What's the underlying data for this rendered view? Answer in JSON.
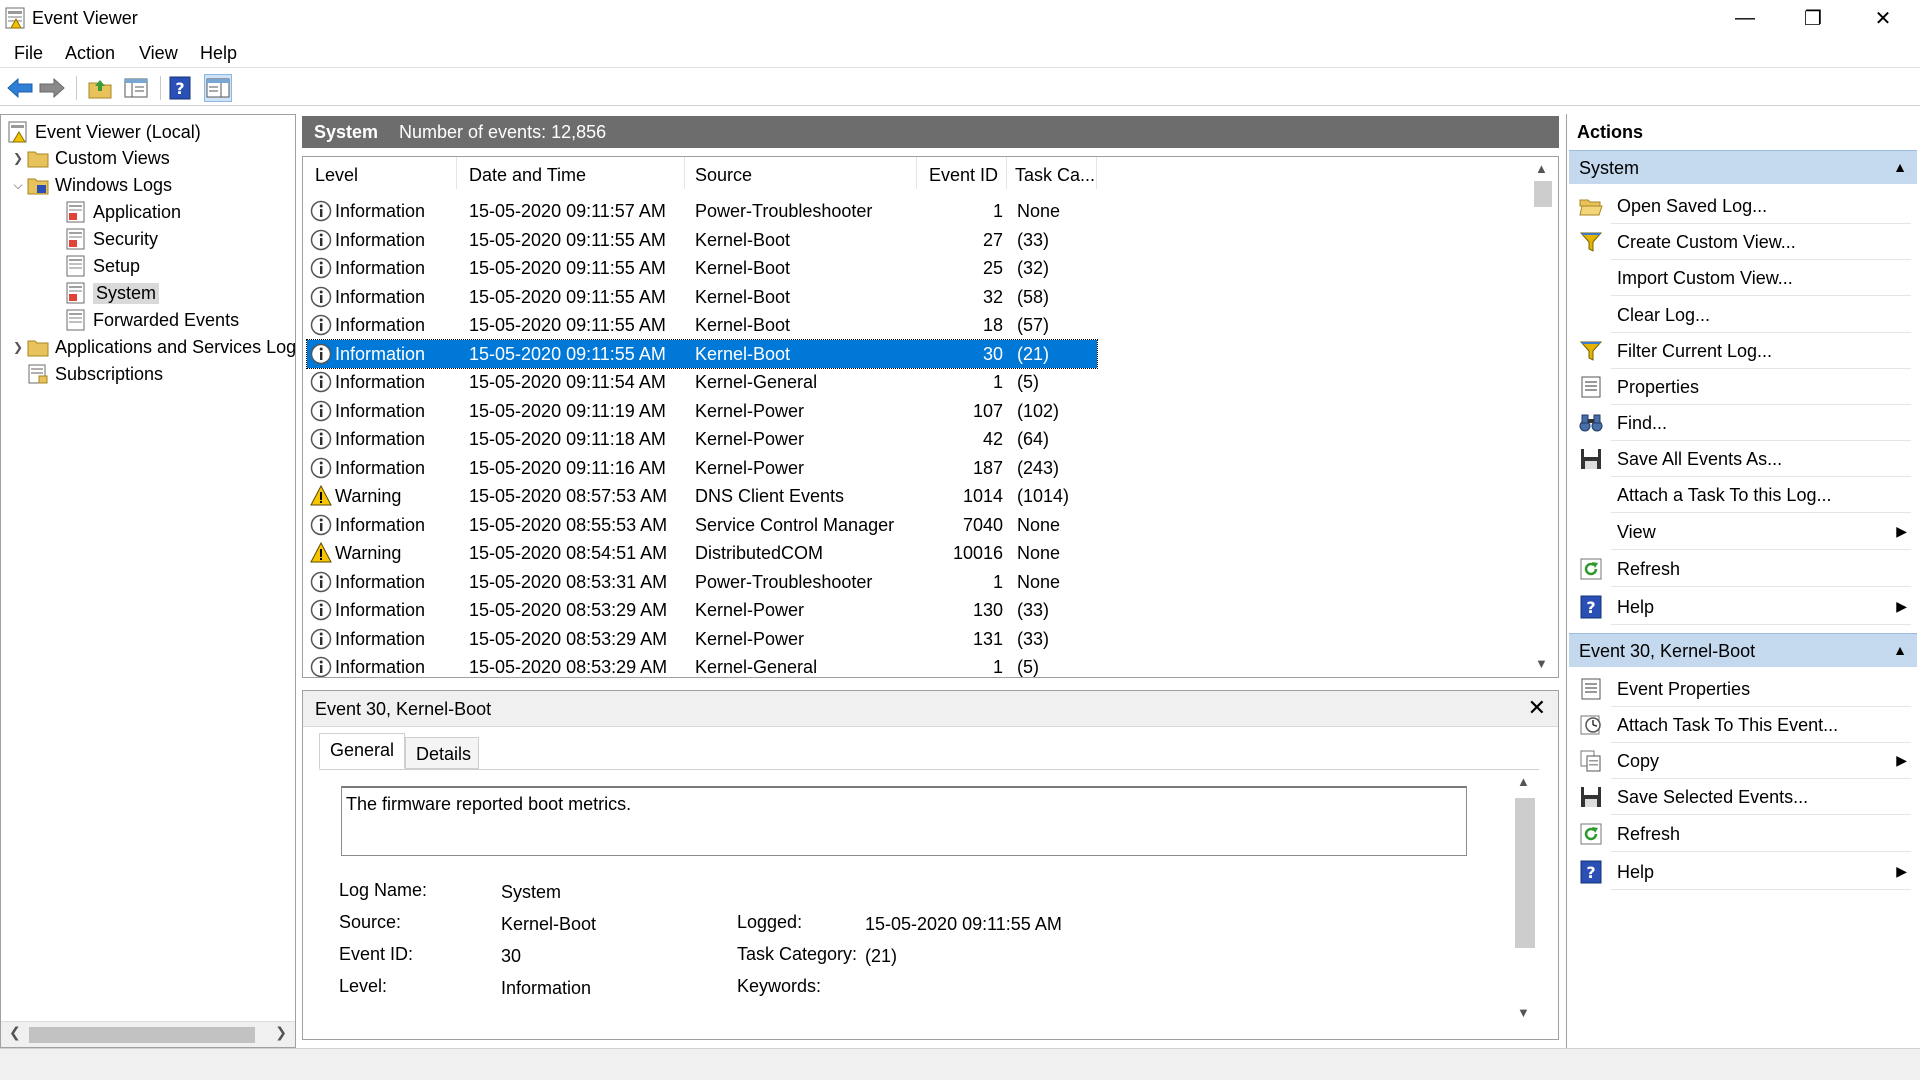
{
  "window": {
    "title": "Event Viewer",
    "minimize": "—",
    "maximize": "❐",
    "close": "✕"
  },
  "menu": {
    "file": "File",
    "action": "Action",
    "view": "View",
    "help": "Help"
  },
  "tree": {
    "root": "Event Viewer (Local)",
    "custom_views": "Custom Views",
    "windows_logs": "Windows Logs",
    "application": "Application",
    "security": "Security",
    "setup": "Setup",
    "system": "System",
    "forwarded_events": "Forwarded Events",
    "apps_services": "Applications and Services Log",
    "subscriptions": "Subscriptions"
  },
  "center": {
    "log_name": "System",
    "event_count": "Number of events: 12,856"
  },
  "columns": {
    "level": "Level",
    "datetime": "Date and Time",
    "source": "Source",
    "event_id": "Event ID",
    "task": "Task Ca..."
  },
  "events": [
    {
      "level": "Information",
      "type": "info",
      "datetime": "15-05-2020 09:11:57 AM",
      "source": "Power-Troubleshooter",
      "id": "1",
      "task": "None"
    },
    {
      "level": "Information",
      "type": "info",
      "datetime": "15-05-2020 09:11:55 AM",
      "source": "Kernel-Boot",
      "id": "27",
      "task": "(33)"
    },
    {
      "level": "Information",
      "type": "info",
      "datetime": "15-05-2020 09:11:55 AM",
      "source": "Kernel-Boot",
      "id": "25",
      "task": "(32)"
    },
    {
      "level": "Information",
      "type": "info",
      "datetime": "15-05-2020 09:11:55 AM",
      "source": "Kernel-Boot",
      "id": "32",
      "task": "(58)"
    },
    {
      "level": "Information",
      "type": "info",
      "datetime": "15-05-2020 09:11:55 AM",
      "source": "Kernel-Boot",
      "id": "18",
      "task": "(57)"
    },
    {
      "level": "Information",
      "type": "info",
      "datetime": "15-05-2020 09:11:55 AM",
      "source": "Kernel-Boot",
      "id": "30",
      "task": "(21)"
    },
    {
      "level": "Information",
      "type": "info",
      "datetime": "15-05-2020 09:11:54 AM",
      "source": "Kernel-General",
      "id": "1",
      "task": "(5)"
    },
    {
      "level": "Information",
      "type": "info",
      "datetime": "15-05-2020 09:11:19 AM",
      "source": "Kernel-Power",
      "id": "107",
      "task": "(102)"
    },
    {
      "level": "Information",
      "type": "info",
      "datetime": "15-05-2020 09:11:18 AM",
      "source": "Kernel-Power",
      "id": "42",
      "task": "(64)"
    },
    {
      "level": "Information",
      "type": "info",
      "datetime": "15-05-2020 09:11:16 AM",
      "source": "Kernel-Power",
      "id": "187",
      "task": "(243)"
    },
    {
      "level": "Warning",
      "type": "warn",
      "datetime": "15-05-2020 08:57:53 AM",
      "source": "DNS Client Events",
      "id": "1014",
      "task": "(1014)"
    },
    {
      "level": "Information",
      "type": "info",
      "datetime": "15-05-2020 08:55:53 AM",
      "source": "Service Control Manager",
      "id": "7040",
      "task": "None"
    },
    {
      "level": "Warning",
      "type": "warn",
      "datetime": "15-05-2020 08:54:51 AM",
      "source": "DistributedCOM",
      "id": "10016",
      "task": "None"
    },
    {
      "level": "Information",
      "type": "info",
      "datetime": "15-05-2020 08:53:31 AM",
      "source": "Power-Troubleshooter",
      "id": "1",
      "task": "None"
    },
    {
      "level": "Information",
      "type": "info",
      "datetime": "15-05-2020 08:53:29 AM",
      "source": "Kernel-Power",
      "id": "130",
      "task": "(33)"
    },
    {
      "level": "Information",
      "type": "info",
      "datetime": "15-05-2020 08:53:29 AM",
      "source": "Kernel-Power",
      "id": "131",
      "task": "(33)"
    },
    {
      "level": "Information",
      "type": "info",
      "datetime": "15-05-2020 08:53:29 AM",
      "source": "Kernel-General",
      "id": "1",
      "task": "(5)"
    }
  ],
  "selected_event_index": 5,
  "details": {
    "title": "Event 30, Kernel-Boot",
    "close": "✕",
    "tab_general": "General",
    "tab_details": "Details",
    "description": "The firmware reported boot metrics.",
    "log_name_label": "Log Name:",
    "log_name": "System",
    "source_label": "Source:",
    "source": "Kernel-Boot",
    "event_id_label": "Event ID:",
    "event_id": "30",
    "level_label": "Level:",
    "level": "Information",
    "logged_label": "Logged:",
    "logged": "15-05-2020 09:11:55 AM",
    "task_label": "Task Category:",
    "task": "(21)",
    "keywords_label": "Keywords:"
  },
  "actions": {
    "title": "Actions",
    "section_system": "System",
    "system_items": [
      {
        "label": "Open Saved Log...",
        "icon": "folder-open-icon",
        "sub": false
      },
      {
        "label": "Create Custom View...",
        "icon": "filter-icon",
        "sub": false
      },
      {
        "label": "Import Custom View...",
        "icon": "",
        "sub": false
      },
      {
        "label": "Clear Log...",
        "icon": "",
        "sub": false
      },
      {
        "label": "Filter Current Log...",
        "icon": "filter-icon",
        "sub": false
      },
      {
        "label": "Properties",
        "icon": "properties-icon",
        "sub": false
      },
      {
        "label": "Find...",
        "icon": "binoculars-icon",
        "sub": false
      },
      {
        "label": "Save All Events As...",
        "icon": "save-icon",
        "sub": false
      },
      {
        "label": "Attach a Task To this Log...",
        "icon": "",
        "sub": false
      },
      {
        "label": "View",
        "icon": "",
        "sub": true
      },
      {
        "label": "Refresh",
        "icon": "refresh-icon",
        "sub": false
      },
      {
        "label": "Help",
        "icon": "help-icon",
        "sub": true
      }
    ],
    "section_event": "Event 30, Kernel-Boot",
    "event_items": [
      {
        "label": "Event Properties",
        "icon": "properties-icon",
        "sub": false
      },
      {
        "label": "Attach Task To This Event...",
        "icon": "task-clock-icon",
        "sub": false
      },
      {
        "label": "Copy",
        "icon": "copy-icon",
        "sub": true
      },
      {
        "label": "Save Selected Events...",
        "icon": "save-icon",
        "sub": false
      },
      {
        "label": "Refresh",
        "icon": "refresh-icon",
        "sub": false
      },
      {
        "label": "Help",
        "icon": "help-icon",
        "sub": true
      }
    ]
  }
}
